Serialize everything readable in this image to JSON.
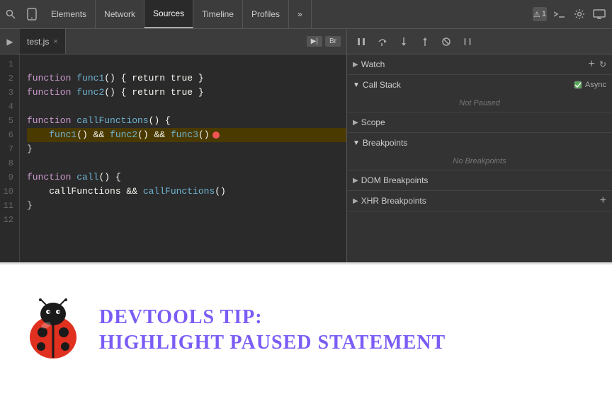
{
  "toolbar": {
    "tabs": [
      {
        "label": "Elements",
        "active": false
      },
      {
        "label": "Network",
        "active": false
      },
      {
        "label": "Sources",
        "active": true
      },
      {
        "label": "Timeline",
        "active": false
      },
      {
        "label": "Profiles",
        "active": false
      }
    ],
    "more_label": "»",
    "badge_label": "1",
    "badge2_label": "1"
  },
  "file_tabs": {
    "filename": "test.js",
    "close_label": "×",
    "btn1": "▶|",
    "btn2": "Br"
  },
  "debug": {
    "pause": "⏸",
    "step_over": "↺",
    "step_into": "↓",
    "step_out": "↑",
    "deactivate": "⊘",
    "pause2": "⏸"
  },
  "code": {
    "lines": [
      {
        "num": 1,
        "text": ""
      },
      {
        "num": 2,
        "text": "function func1() { return true }"
      },
      {
        "num": 3,
        "text": "function func2() { return true }"
      },
      {
        "num": 4,
        "text": ""
      },
      {
        "num": 5,
        "text": "function callFunctions() {"
      },
      {
        "num": 6,
        "text": "    func1() && func2() && func3()"
      },
      {
        "num": 7,
        "text": "}"
      },
      {
        "num": 8,
        "text": ""
      },
      {
        "num": 9,
        "text": "function call() {"
      },
      {
        "num": 10,
        "text": "    callFunctions && callFunctions()"
      },
      {
        "num": 11,
        "text": "}"
      },
      {
        "num": 12,
        "text": ""
      }
    ]
  },
  "panels": {
    "watch": {
      "label": "Watch",
      "add_label": "+",
      "refresh_label": "↻",
      "expanded": true
    },
    "call_stack": {
      "label": "Call Stack",
      "async_label": "Async",
      "status": "Not Paused",
      "expanded": true
    },
    "scope": {
      "label": "Scope",
      "expanded": false
    },
    "breakpoints": {
      "label": "Breakpoints",
      "status": "No Breakpoints",
      "expanded": true
    },
    "dom_breakpoints": {
      "label": "DOM Breakpoints",
      "expanded": false
    },
    "xhr_breakpoints": {
      "label": "XHR Breakpoints",
      "expanded": false
    }
  },
  "tip": {
    "title": "DevTools Tip:",
    "subtitle": "Highlight Paused Statement"
  }
}
